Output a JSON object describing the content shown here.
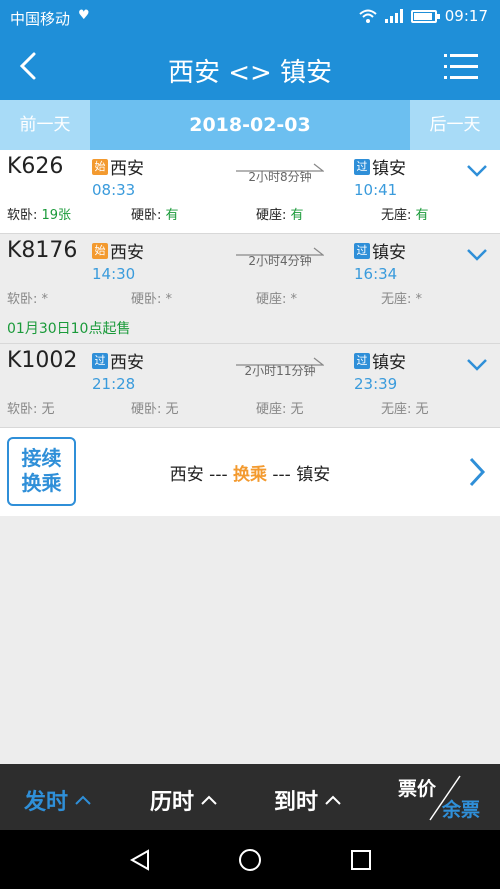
{
  "status_bar": {
    "carrier": "中国移动",
    "time": "09:17"
  },
  "header": {
    "title": "西安 <> 镇安"
  },
  "date_bar": {
    "prev_label": "前一天",
    "date": "2018-02-03",
    "next_label": "后一天"
  },
  "trains": [
    {
      "number": "K626",
      "from_tag": "始",
      "from": "西安",
      "depart": "08:33",
      "duration": "2小时8分钟",
      "to_tag": "过",
      "to": "镇安",
      "arrive": "10:41",
      "seats": [
        {
          "label": "软卧: ",
          "value": "19张"
        },
        {
          "label": "硬卧: ",
          "value": "有"
        },
        {
          "label": "硬座: ",
          "value": "有"
        },
        {
          "label": "无座: ",
          "value": "有"
        }
      ]
    },
    {
      "number": "K8176",
      "from_tag": "始",
      "from": "西安",
      "depart": "14:30",
      "duration": "2小时4分钟",
      "to_tag": "过",
      "to": "镇安",
      "arrive": "16:34",
      "seats": [
        {
          "label": "软卧: ",
          "value": "*"
        },
        {
          "label": "硬卧: ",
          "value": "*"
        },
        {
          "label": "硬座: ",
          "value": "*"
        },
        {
          "label": "无座: ",
          "value": "*"
        }
      ],
      "presale": "01月30日10点起售"
    },
    {
      "number": "K1002",
      "from_tag": "过",
      "from": "西安",
      "depart": "21:28",
      "duration": "2小时11分钟",
      "to_tag": "过",
      "to": "镇安",
      "arrive": "23:39",
      "seats": [
        {
          "label": "软卧: ",
          "value": "无"
        },
        {
          "label": "硬卧: ",
          "value": "无"
        },
        {
          "label": "硬座: ",
          "value": "无"
        },
        {
          "label": "无座: ",
          "value": "无"
        }
      ]
    }
  ],
  "transfer": {
    "badge_line1": "接续",
    "badge_line2": "换乘",
    "from": "西安",
    "sep1": " --- ",
    "via": "换乘",
    "sep2": " --- ",
    "to": "镇安"
  },
  "sort_bar": {
    "depart_label": "发时",
    "duration_label": "历时",
    "arrive_label": "到时",
    "price_label": "票价",
    "remaining_label": "余票"
  },
  "colors": {
    "primary": "#1f8fd8",
    "accent": "#f39a2f",
    "available": "#1a9a3a"
  }
}
